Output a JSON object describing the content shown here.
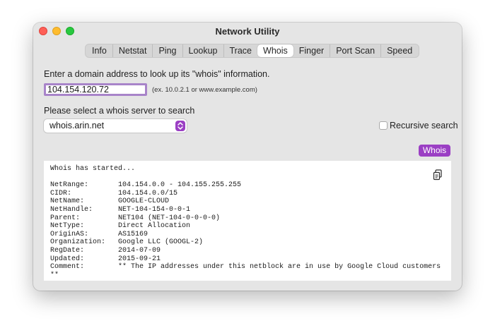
{
  "window": {
    "title": "Network Utility"
  },
  "tabs": [
    {
      "label": "Info",
      "active": false
    },
    {
      "label": "Netstat",
      "active": false
    },
    {
      "label": "Ping",
      "active": false
    },
    {
      "label": "Lookup",
      "active": false
    },
    {
      "label": "Trace",
      "active": false
    },
    {
      "label": "Whois",
      "active": true
    },
    {
      "label": "Finger",
      "active": false
    },
    {
      "label": "Port Scan",
      "active": false
    },
    {
      "label": "Speed",
      "active": false
    }
  ],
  "whois": {
    "prompt": "Enter a domain address to look up its \"whois\" information.",
    "domain_value": "104.154.120.72",
    "domain_hint": "(ex. 10.0.2.1 or www.example.com)",
    "server_prompt": "Please select a whois server to search",
    "server_selected": "whois.arin.net",
    "recursive_label": "Recursive search",
    "recursive_checked": false,
    "button_label": "Whois",
    "output": "Whois has started...\n\nNetRange:       104.154.0.0 - 104.155.255.255\nCIDR:           104.154.0.0/15\nNetName:        GOOGLE-CLOUD\nNetHandle:      NET-104-154-0-0-1\nParent:         NET104 (NET-104-0-0-0-0)\nNetType:        Direct Allocation\nOriginAS:       AS15169\nOrganization:   Google LLC (GOOGL-2)\nRegDate:        2014-07-09\nUpdated:        2015-09-21\nComment:        ** The IP addresses under this netblock are in use by Google Cloud customers\n**"
  },
  "icons": {
    "copy": "copy-icon",
    "stepper": "chevron-up-down-icon"
  },
  "colors": {
    "accent": "#9b3fc4",
    "window_bg": "#e5e5e5",
    "focus_ring": "#a884c9"
  }
}
